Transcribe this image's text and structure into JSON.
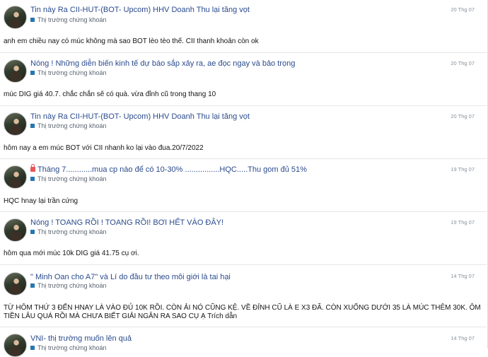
{
  "posts": [
    {
      "title": "Tin này Ra CII-HUT-(BOT- Upcom) HHV Doanh Thu lại tăng vọt",
      "forum": "Thị trường chứng khoán",
      "date": "20 Thg 07",
      "snippet": "anh em chiều nay có múc không mà sao BOT lèo tèo thế. CII thanh khoản còn ok",
      "locked": false
    },
    {
      "title": "Nóng ! Những diễn biến kinh tế dự báo sắp xảy ra, ae đọc ngay và bảo trọng",
      "forum": "Thị trường chứng khoán",
      "date": "20 Thg 07",
      "snippet": "múc DIG giá 40.7. chắc chắn sẽ có quà. vừa đỉnh cũ trong thang 10",
      "locked": false
    },
    {
      "title": "Tin này Ra CII-HUT-(BOT- Upcom) HHV Doanh Thu lại tăng vọt",
      "forum": "Thị trường chứng khoán",
      "date": "20 Thg 07",
      "snippet": "hôm nay a em múc BOT với CII nhanh ko lại vào đua.20/7/2022",
      "locked": false
    },
    {
      "title": "Tháng 7............mua cp nào để có 10-30% ................HQC.....Thu gom đủ 51%",
      "forum": "Thị trường chứng khoán",
      "date": "19 Thg 07",
      "snippet": "HQC hnay lại trần cứng",
      "locked": true
    },
    {
      "title": "Nóng ! TOANG RỒI ! TOANG RỒI! BƠI HẾT VÀO ĐÂY!",
      "forum": "Thị trường chứng khoán",
      "date": "19 Thg 07",
      "snippet": "hôm qua mới múc 10k DIG giá 41.75 cụ ơi.",
      "locked": false
    },
    {
      "title": "\" Minh Oan cho A7\" và Lí do đầu tư theo môi giới là tai hại",
      "forum": "Thị trường chứng khoán",
      "date": "14 Thg 07",
      "snippet": "TỪ HÔM THỨ 3 ĐẾN HNAY LÀ VÀO ĐỦ 10K RỒI. CÒN ẢI NÓ CŨNG KỆ. VỀ ĐỈNH CŨ LÀ E X3 ĐÃ. CÒN XUỐNG DƯỚI 35 LÀ MÚC THÊM 30K. ÔM TIỀN LÂU QUÁ RỒI MÀ CHƯA BIẾT GIẢI NGÂN RA SAO CỤ Ạ Trích dẫn",
      "locked": false
    },
    {
      "title": "VNI- thị trường muốn lên quả",
      "forum": "Thị trường chứng khoán",
      "date": "14 Thg 07",
      "snippet": "",
      "locked": false
    }
  ]
}
